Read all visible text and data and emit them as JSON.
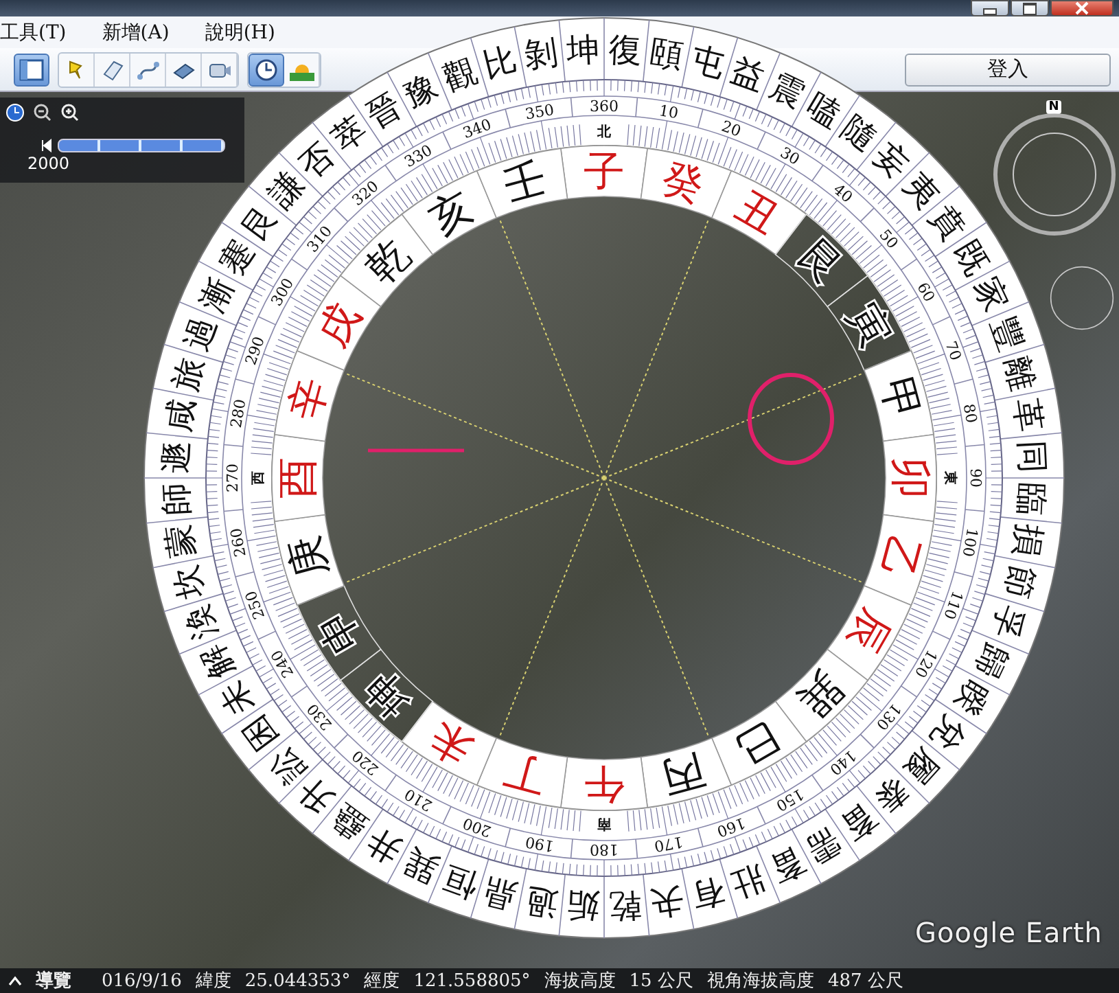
{
  "menu": [
    "工具(T)",
    "新增(A)",
    "說明(H)"
  ],
  "toolbar": {
    "login_button": "登入"
  },
  "time_slider": {
    "year": "2000"
  },
  "nav_control": {
    "north": "N"
  },
  "compass": {
    "hexagrams": [
      "坤",
      "復",
      "頤",
      "屯",
      "益",
      "震",
      "嗑",
      "隨",
      "妄",
      "夷",
      "賁",
      "既",
      "家",
      "豐",
      "離",
      "革",
      "同",
      "臨",
      "損",
      "節",
      "孚",
      "歸",
      "睽",
      "兌",
      "履",
      "泰",
      "畜",
      "需",
      "畜",
      "壯",
      "有",
      "夬",
      "乾",
      "姤",
      "過",
      "鼎",
      "恒",
      "巽",
      "井",
      "蠱",
      "升",
      "訟",
      "困",
      "未",
      "解",
      "渙",
      "坎",
      "蒙",
      "師",
      "遯",
      "咸",
      "旅",
      "過",
      "漸",
      "蹇",
      "艮",
      "謙",
      "否",
      "萃",
      "晉",
      "豫",
      "觀",
      "比",
      "剝"
    ],
    "degree_labels": [
      "10",
      "20",
      "30",
      "40",
      "50",
      "60",
      "70",
      "80",
      "90",
      "100",
      "110",
      "120",
      "130",
      "140",
      "150",
      "160",
      "170",
      "180",
      "190",
      "200",
      "210",
      "220",
      "230",
      "240",
      "250",
      "260",
      "270",
      "280",
      "290",
      "300",
      "310",
      "320",
      "330",
      "340",
      "350",
      "360"
    ],
    "cardinals": [
      "北",
      "東",
      "南",
      "西"
    ],
    "mountains": [
      {
        "char": "子",
        "color": "#d01818",
        "clear": false
      },
      {
        "char": "癸",
        "color": "#d01818",
        "clear": false
      },
      {
        "char": "丑",
        "color": "#d01818",
        "clear": false
      },
      {
        "char": "艮",
        "color": "#111111",
        "clear": true
      },
      {
        "char": "寅",
        "color": "#111111",
        "clear": true
      },
      {
        "char": "甲",
        "color": "#111111",
        "clear": false
      },
      {
        "char": "卯",
        "color": "#d01818",
        "clear": false
      },
      {
        "char": "乙",
        "color": "#d01818",
        "clear": false
      },
      {
        "char": "辰",
        "color": "#d01818",
        "clear": false
      },
      {
        "char": "巽",
        "color": "#111111",
        "clear": false
      },
      {
        "char": "巳",
        "color": "#111111",
        "clear": false
      },
      {
        "char": "丙",
        "color": "#111111",
        "clear": false
      },
      {
        "char": "午",
        "color": "#d01818",
        "clear": false
      },
      {
        "char": "丁",
        "color": "#d01818",
        "clear": false
      },
      {
        "char": "未",
        "color": "#d01818",
        "clear": false
      },
      {
        "char": "坤",
        "color": "#111111",
        "clear": true
      },
      {
        "char": "申",
        "color": "#111111",
        "clear": true
      },
      {
        "char": "庚",
        "color": "#111111",
        "clear": false
      },
      {
        "char": "酉",
        "color": "#d01818",
        "clear": false
      },
      {
        "char": "辛",
        "color": "#d01818",
        "clear": false
      },
      {
        "char": "戌",
        "color": "#d01818",
        "clear": false
      },
      {
        "char": "乾",
        "color": "#111111",
        "clear": false
      },
      {
        "char": "亥",
        "color": "#111111",
        "clear": false
      },
      {
        "char": "壬",
        "color": "#111111",
        "clear": false
      }
    ]
  },
  "logo": "Google Earth",
  "status_bar": {
    "nav": "導覽",
    "date": "016/9/16",
    "latitude_label": "緯度",
    "latitude": "25.044353°",
    "longitude_label": "經度",
    "longitude": "121.558805°",
    "elevation_label": "海拔高度",
    "elevation": "15 公尺",
    "eye_label": "視角海拔高度",
    "eye": "487 公尺"
  }
}
